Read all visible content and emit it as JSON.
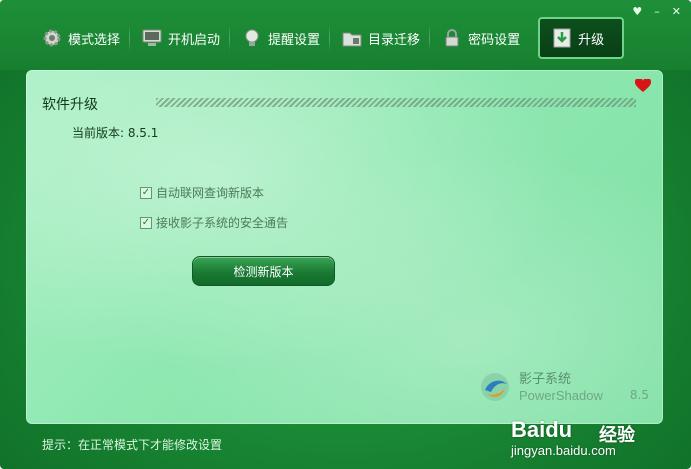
{
  "window": {
    "controls": {
      "skin": "♥",
      "minimize": "–",
      "close": "✕"
    }
  },
  "toolbar": {
    "tabs": [
      {
        "label": "模式选择",
        "icon": "gear-icon"
      },
      {
        "label": "开机启动",
        "icon": "monitor-icon"
      },
      {
        "label": "提醒设置",
        "icon": "bulb-icon"
      },
      {
        "label": "目录迁移",
        "icon": "folder-icon"
      },
      {
        "label": "密码设置",
        "icon": "lock-icon"
      },
      {
        "label": "升级",
        "icon": "download-icon",
        "active": true
      }
    ]
  },
  "panel": {
    "section_title": "软件升级",
    "current_version": "当前版本: 8.5.1",
    "options": [
      {
        "label": "自动联网查询新版本",
        "checked": true
      },
      {
        "label": "接收影子系统的安全通告",
        "checked": true
      }
    ],
    "check_button": "检测新版本",
    "brand": {
      "cn": "影子系统",
      "en": "PowerShadow",
      "version": "8.5"
    }
  },
  "status": {
    "hint": "提示：在正常模式下才能修改设置"
  },
  "watermark": {
    "baidu": "Baidu",
    "jingyan": "经验",
    "url": "jingyan.baidu.com"
  },
  "colors": {
    "accent": "#1a8a35",
    "panel": "#8ee8b0",
    "active_tab": "#0a3f16",
    "heart": "#d91414"
  }
}
